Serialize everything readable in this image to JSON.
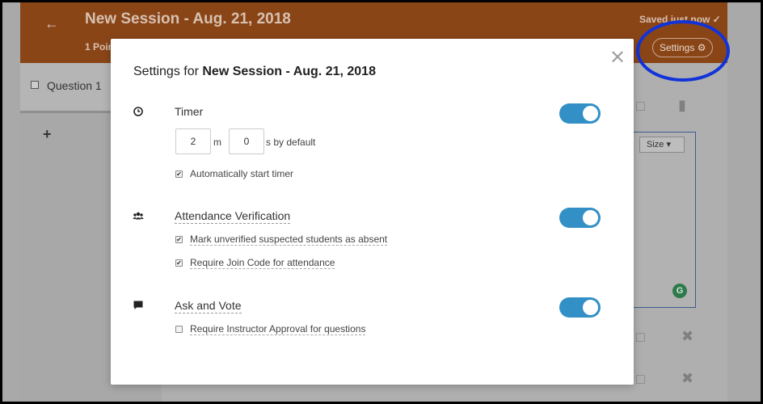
{
  "app": {
    "session_title": "New Session - Aug. 21, 2018",
    "points_text": "1 Poin",
    "saved_text": "Saved just now ✓",
    "settings_button": "Settings ⚙",
    "question_label": "Question 1",
    "add_question": "+",
    "size_select": "Size ▾",
    "grammarly_icon": "G",
    "highlight_color": "#1133d9",
    "header_color": "#8a4517"
  },
  "modal": {
    "title_prefix": "Settings for ",
    "title_session": "New Session - Aug. 21, 2018",
    "close": "✕",
    "toggle_color": "#3290c6",
    "timer": {
      "label": "Timer",
      "icon": "clock-icon",
      "enabled": true,
      "minutes_value": "2",
      "minutes_unit": "m",
      "seconds_value": "0",
      "seconds_unit": "s by default",
      "auto_start_label": "Automatically start timer",
      "auto_start_checked": true
    },
    "attendance": {
      "label": "Attendance Verification",
      "icon": "users-icon",
      "enabled": true,
      "options": [
        {
          "label": "Mark unverified suspected students as absent",
          "checked": true
        },
        {
          "label": "Require Join Code for attendance",
          "checked": true
        }
      ]
    },
    "ask_vote": {
      "label": "Ask and Vote",
      "icon": "comment-icon",
      "enabled": true,
      "options": [
        {
          "label": "Require Instructor Approval for questions",
          "checked": false
        }
      ]
    }
  }
}
